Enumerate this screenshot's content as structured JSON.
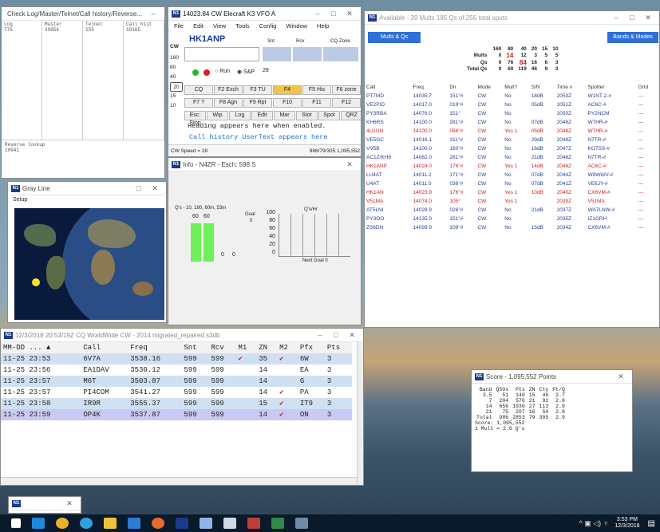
{
  "check": {
    "title": "Check Log/Master/Telnet/Call history/Reverse...",
    "cols": [
      {
        "h": "Log",
        "v": "776"
      },
      {
        "h": "Master",
        "v": "39956"
      },
      {
        "h": "Telnet",
        "v": "155"
      },
      {
        "h": "Call hist",
        "v": "10165"
      }
    ],
    "reverse_label": "Reverse lookup",
    "reverse_value": "10941"
  },
  "gray": {
    "title": "Gray Line",
    "setup": "Setup"
  },
  "vfo": {
    "title": "14023.84 CW Elecraft K3 VFO A",
    "menu": [
      "File",
      "Edit",
      "View",
      "Tools",
      "Config",
      "Window",
      "Help"
    ],
    "call": "HK1ANP",
    "snt_label": "Snt",
    "rcv_label": "Rcv",
    "zone_label": "CQ-Zone",
    "mode_label": "CW",
    "bands": [
      "160",
      "80",
      "40",
      "20",
      "15",
      "10"
    ],
    "run_label": "Run",
    "sp_label": "S&P",
    "rate": "28",
    "frow1": [
      "CQ",
      "F2 Exch",
      "F3 TU",
      "F4",
      "F5 His",
      "F6 zone"
    ],
    "frow2": [
      "F7 ?",
      "F8 Agn",
      "F9 Rpt",
      "F10",
      "F11",
      "F12"
    ],
    "frow3": [
      "Esc: Stop",
      "Wip",
      "Log",
      "Edit",
      "Mar",
      "Stor",
      "Spot",
      "QRZ"
    ],
    "heading": "Heading appears here when enabled.",
    "callhist": "Call history UserText appears here",
    "speed": "CW Speed = 28",
    "score": "986/79/305  1,095,552"
  },
  "info": {
    "title": "Info - N4ZR - Esch: 598 S",
    "qs_label": "Q's - 10, 180, 60m, 53m",
    "v1": "60",
    "v2": "60",
    "goal_label": "Goal",
    "goal_val": "0",
    "z1": "0",
    "z2": "0",
    "rate_label": "Q's/Hr",
    "next_goal": "Next Goal 0",
    "yticks": [
      "100",
      "80",
      "60",
      "40",
      "20",
      "0"
    ]
  },
  "avail": {
    "title": "Available - 39 Mults 185 Qs of 256 total spots",
    "tab_left": "Mults & Qs",
    "tab_right": "Bands & Modes",
    "sum_bands": [
      "160",
      "80",
      "40",
      "20",
      "15",
      "10"
    ],
    "sum_rows": [
      {
        "label": "Mults",
        "v": [
          "0",
          "14",
          "12",
          "3",
          "5",
          "5"
        ]
      },
      {
        "label": "Qs",
        "v": [
          "0",
          "76",
          "84",
          "16",
          "6",
          "3"
        ]
      },
      {
        "label": "Total Qs",
        "v": [
          "0",
          "60",
          "119",
          "46",
          "9",
          "3"
        ]
      }
    ],
    "headers": [
      "Call",
      "Freq",
      "Dir",
      "Mode",
      "Mult?",
      "S/N",
      "Time v",
      "Spotter",
      "Grid"
    ],
    "rows": [
      {
        "c": "blue",
        "v": [
          "PT7MD",
          "14035.7",
          "151°#",
          "CW",
          "No",
          "18dB",
          "2053Z",
          "W1NT-2-#",
          "---"
        ]
      },
      {
        "c": "blue",
        "v": [
          "VE2PID",
          "14017.0",
          "019°#",
          "CW",
          "No",
          "05dB",
          "2051Z",
          "AC6C-#",
          "---"
        ]
      },
      {
        "c": "blue",
        "v": [
          "PY3RBA",
          "14076.0",
          "151°",
          "CW",
          "No",
          "",
          "2050Z",
          "PY2NCM",
          "---"
        ]
      },
      {
        "c": "blue",
        "v": [
          "KH6RS",
          "14100.0",
          "281°#",
          "CW",
          "No",
          "07dB",
          "2048Z",
          "W7HR-#",
          "---"
        ]
      },
      {
        "c": "red",
        "v": [
          "4U1UN",
          "14100.0",
          "056°#",
          "CW",
          "Yes 1",
          "05dB",
          "2048Z",
          "W7HR-#",
          "---"
        ]
      },
      {
        "c": "blue",
        "v": [
          "VE5GC",
          "14016.1",
          "311°#",
          "CW",
          "No",
          "29dB",
          "2048Z",
          "N7TR-#",
          "---"
        ]
      },
      {
        "c": "blue",
        "v": [
          "VV5B",
          "14100.0",
          "160°#",
          "CW",
          "No",
          "16dB",
          "2047Z",
          "KO7SS-#",
          "---"
        ]
      },
      {
        "c": "blue",
        "v": [
          "AC1Z/KH6",
          "14062.0",
          "281°#",
          "CW",
          "No",
          "21dB",
          "2046Z",
          "N7TR-#",
          "---"
        ]
      },
      {
        "c": "red",
        "v": [
          "HK1ANP",
          "14024.0",
          "176°#",
          "CW",
          "Yes 1",
          "14dB",
          "2046Z",
          "AC6C-#",
          "---"
        ]
      },
      {
        "c": "blue",
        "v": [
          "LU4AT",
          "14011.2",
          "171°#",
          "CW",
          "No",
          "07dB",
          "2044Z",
          "W8WWV-#",
          "---"
        ]
      },
      {
        "c": "blue",
        "v": [
          "U4AT",
          "14011.0",
          "036°#",
          "CW",
          "No",
          "07dB",
          "2041Z",
          "VE6JY-#",
          "---"
        ]
      },
      {
        "c": "red",
        "v": [
          "HK1AN",
          "14023.9",
          "176°#",
          "CW",
          "Yes 1",
          "10dB",
          "2040Z",
          "CX6VM-#",
          "---"
        ]
      },
      {
        "c": "red",
        "v": [
          "V51MA",
          "14074.0",
          "105°",
          "CW",
          "Yes 1",
          "",
          "2039Z",
          "V51MA",
          "---"
        ]
      },
      {
        "c": "blue",
        "v": [
          "AT5LNI",
          "14028.9",
          "026°#",
          "CW",
          "No",
          "21dB",
          "2037Z",
          "WA7LNW-#",
          "---"
        ]
      },
      {
        "c": "blue",
        "v": [
          "PY3OO",
          "14135.0",
          "151°#",
          "CW",
          "No",
          "",
          "2035Z",
          "IZ1GRH",
          "---"
        ]
      },
      {
        "c": "blue",
        "v": [
          "ZS6DN",
          "14099.9",
          "108°#",
          "CW",
          "No",
          "15dB",
          "2034Z",
          "CX6VM-#",
          "---"
        ]
      }
    ]
  },
  "log": {
    "title": "12/3/2018 20:53/19Z CQ WorldWide CW - 2014 migrated_repaired.s3db",
    "headers": [
      "MM-DD ... ▲",
      "Call",
      "Freq",
      "Snt",
      "Rcv",
      "M1",
      "ZN",
      "M2",
      "Pfx",
      "Pts"
    ],
    "rows": [
      {
        "v": [
          "11-25 23:53",
          "6V7A",
          "3538.16",
          "599",
          "599",
          "✔",
          "35",
          "✔",
          "6W",
          "3"
        ],
        "bg": "#cfe0f2"
      },
      {
        "v": [
          "11-25 23:56",
          "EA1DAV",
          "3530.12",
          "599",
          "599",
          "",
          "14",
          "",
          "EA",
          "3"
        ],
        "bg": "#ffffff"
      },
      {
        "v": [
          "11-25 23:57",
          "M6T",
          "3503.87",
          "599",
          "599",
          "",
          "14",
          "",
          "G",
          "3"
        ],
        "bg": "#cfe0f2"
      },
      {
        "v": [
          "11-25 23:57",
          "PI4COM",
          "3541.27",
          "599",
          "599",
          "",
          "14",
          "✔",
          "PA",
          "3"
        ],
        "bg": "#ffffff"
      },
      {
        "v": [
          "11-25 23:58",
          "IR9R",
          "3555.37",
          "599",
          "599",
          "",
          "15",
          "✔",
          "IT9",
          "3"
        ],
        "bg": "#cfe0f2"
      },
      {
        "v": [
          "11-25 23:59",
          "OP4K",
          "3537.87",
          "599",
          "599",
          "",
          "14",
          "✔",
          "ON",
          "3"
        ],
        "bg": "#c9c9f3"
      }
    ]
  },
  "score": {
    "title": "Score - 1,095,552 Points",
    "headers": [
      "Band",
      "QSOs",
      "Pts",
      "ZN",
      "Cty",
      "Pt/Q"
    ],
    "rows": [
      [
        "3.5",
        "51",
        "140",
        "15",
        "46",
        "2.7"
      ],
      [
        "7",
        "204",
        "576",
        "21",
        "92",
        "2.8"
      ],
      [
        "14",
        "656",
        "1930",
        "27",
        "113",
        "2.9"
      ],
      [
        "21",
        "75",
        "207",
        "16",
        "54",
        "2.8"
      ],
      [
        "Total",
        "986",
        "2853",
        "79",
        "305",
        "2.9"
      ]
    ],
    "line1": "Score: 1,095,552",
    "line2": "1 Mult = 2.6 Q's"
  },
  "taskbar": {
    "time": "3:53 PM",
    "date": "12/3/2018"
  }
}
